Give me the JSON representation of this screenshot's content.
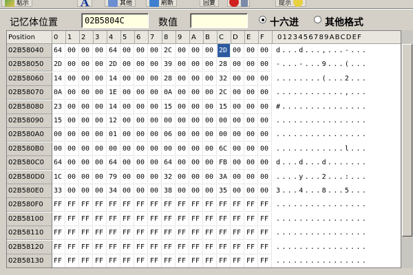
{
  "toolbar": {
    "buttons": [
      {
        "label": "粘示",
        "icon": "paste-icon"
      },
      {
        "label": "A",
        "icon": "font-icon"
      },
      {
        "label": "其他",
        "icon": "other-icon"
      },
      {
        "label": "刷新",
        "icon": "refresh-icon"
      },
      {
        "label": "回复",
        "icon": "restore-icon"
      },
      {
        "label": "",
        "icon": "stop-icon"
      },
      {
        "label": "提示",
        "icon": "hint-icon"
      }
    ]
  },
  "address_bar": {
    "location_label": "记忆体位置",
    "location_value": "02B5804C",
    "value_label": "数值",
    "value_value": "",
    "radio_hex_label": "十六进",
    "radio_other_label": "其他格式",
    "selected_format": "hex"
  },
  "grid": {
    "headers": [
      "Position",
      "0",
      "1",
      "2",
      "3",
      "4",
      "5",
      "6",
      "7",
      "8",
      "9",
      "A",
      "B",
      "C",
      "D",
      "E",
      "F",
      "0123456789ABCDEF"
    ],
    "rows": [
      {
        "addr": "02B58040",
        "bytes": [
          "64",
          "00",
          "00",
          "00",
          "64",
          "00",
          "00",
          "00",
          "2C",
          "00",
          "00",
          "00",
          "2D",
          "00",
          "00",
          "00"
        ],
        "ascii": "d...d...,...-..."
      },
      {
        "addr": "02B58050",
        "bytes": [
          "2D",
          "00",
          "00",
          "00",
          "2D",
          "00",
          "00",
          "00",
          "39",
          "00",
          "00",
          "00",
          "28",
          "00",
          "00",
          "00"
        ],
        "ascii": "-...-...9...(..."
      },
      {
        "addr": "02B58060",
        "bytes": [
          "14",
          "00",
          "00",
          "00",
          "14",
          "00",
          "00",
          "00",
          "28",
          "00",
          "00",
          "00",
          "32",
          "00",
          "00",
          "00"
        ],
        "ascii": "........(...2..."
      },
      {
        "addr": "02B58070",
        "bytes": [
          "0A",
          "00",
          "00",
          "00",
          "1E",
          "00",
          "00",
          "00",
          "0A",
          "00",
          "00",
          "00",
          "2C",
          "00",
          "00",
          "00"
        ],
        "ascii": "............,..."
      },
      {
        "addr": "02B58080",
        "bytes": [
          "23",
          "00",
          "00",
          "00",
          "14",
          "00",
          "00",
          "00",
          "15",
          "00",
          "00",
          "00",
          "15",
          "00",
          "00",
          "00"
        ],
        "ascii": "#..............."
      },
      {
        "addr": "02B58090",
        "bytes": [
          "15",
          "00",
          "00",
          "00",
          "12",
          "00",
          "00",
          "00",
          "00",
          "00",
          "00",
          "00",
          "00",
          "00",
          "00",
          "00"
        ],
        "ascii": "................"
      },
      {
        "addr": "02B580A0",
        "bytes": [
          "00",
          "00",
          "00",
          "00",
          "01",
          "00",
          "00",
          "00",
          "06",
          "00",
          "00",
          "00",
          "00",
          "00",
          "00",
          "00"
        ],
        "ascii": "................"
      },
      {
        "addr": "02B580B0",
        "bytes": [
          "00",
          "00",
          "00",
          "00",
          "00",
          "00",
          "00",
          "00",
          "00",
          "00",
          "00",
          "00",
          "6C",
          "00",
          "00",
          "00"
        ],
        "ascii": "............l..."
      },
      {
        "addr": "02B580C0",
        "bytes": [
          "64",
          "00",
          "00",
          "00",
          "64",
          "00",
          "00",
          "00",
          "64",
          "00",
          "00",
          "00",
          "FB",
          "00",
          "00",
          "00"
        ],
        "ascii": "d...d...d......."
      },
      {
        "addr": "02B580D0",
        "bytes": [
          "1C",
          "00",
          "00",
          "00",
          "79",
          "00",
          "00",
          "00",
          "32",
          "00",
          "00",
          "00",
          "3A",
          "00",
          "00",
          "00"
        ],
        "ascii": "....y...2...:..."
      },
      {
        "addr": "02B580E0",
        "bytes": [
          "33",
          "00",
          "00",
          "00",
          "34",
          "00",
          "00",
          "00",
          "38",
          "00",
          "00",
          "00",
          "35",
          "00",
          "00",
          "00"
        ],
        "ascii": "3...4...8...5..."
      },
      {
        "addr": "02B580F0",
        "bytes": [
          "FF",
          "FF",
          "FF",
          "FF",
          "FF",
          "FF",
          "FF",
          "FF",
          "FF",
          "FF",
          "FF",
          "FF",
          "FF",
          "FF",
          "FF",
          "FF"
        ],
        "ascii": "................"
      },
      {
        "addr": "02B58100",
        "bytes": [
          "FF",
          "FF",
          "FF",
          "FF",
          "FF",
          "FF",
          "FF",
          "FF",
          "FF",
          "FF",
          "FF",
          "FF",
          "FF",
          "FF",
          "FF",
          "FF"
        ],
        "ascii": "................"
      },
      {
        "addr": "02B58110",
        "bytes": [
          "FF",
          "FF",
          "FF",
          "FF",
          "FF",
          "FF",
          "FF",
          "FF",
          "FF",
          "FF",
          "FF",
          "FF",
          "FF",
          "FF",
          "FF",
          "FF"
        ],
        "ascii": "................"
      },
      {
        "addr": "02B58120",
        "bytes": [
          "FF",
          "FF",
          "FF",
          "FF",
          "FF",
          "FF",
          "FF",
          "FF",
          "FF",
          "FF",
          "FF",
          "FF",
          "FF",
          "FF",
          "FF",
          "FF"
        ],
        "ascii": "................"
      },
      {
        "addr": "02B58130",
        "bytes": [
          "FF",
          "FF",
          "FF",
          "FF",
          "FF",
          "FF",
          "FF",
          "FF",
          "FF",
          "FF",
          "FF",
          "FF",
          "FF",
          "FF",
          "FF",
          "FF"
        ],
        "ascii": "................"
      }
    ],
    "selected": {
      "row": 0,
      "col": 12
    },
    "selection_color": "#2c5aa0"
  }
}
